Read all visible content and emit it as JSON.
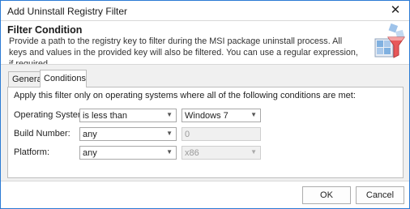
{
  "window": {
    "title": "Add Uninstall Registry Filter",
    "close_glyph": "✕"
  },
  "header": {
    "title": "Filter Condition",
    "description": "Provide a path to the registry key to filter during the MSI package uninstall process. All keys and values in the provided key will also be filtered. You can use a regular expression, if required.",
    "icon": "registry-filter-icon"
  },
  "tabs": [
    {
      "label": "General",
      "selected": false
    },
    {
      "label": "Conditions",
      "selected": true
    }
  ],
  "conditions": {
    "description": "Apply this filter only on operating systems where all of the following conditions are met:",
    "operating_system": {
      "label": "Operating System:",
      "operator": "is less than",
      "value": "Windows 7"
    },
    "build_number": {
      "label": "Build Number:",
      "operator": "any",
      "value": "0"
    },
    "platform": {
      "label": "Platform:",
      "operator": "any",
      "value": "x86"
    }
  },
  "footer": {
    "ok_label": "OK",
    "cancel_label": "Cancel"
  },
  "colors": {
    "window_border": "#2b7bd4",
    "content_bg": "#f0f0f0"
  }
}
